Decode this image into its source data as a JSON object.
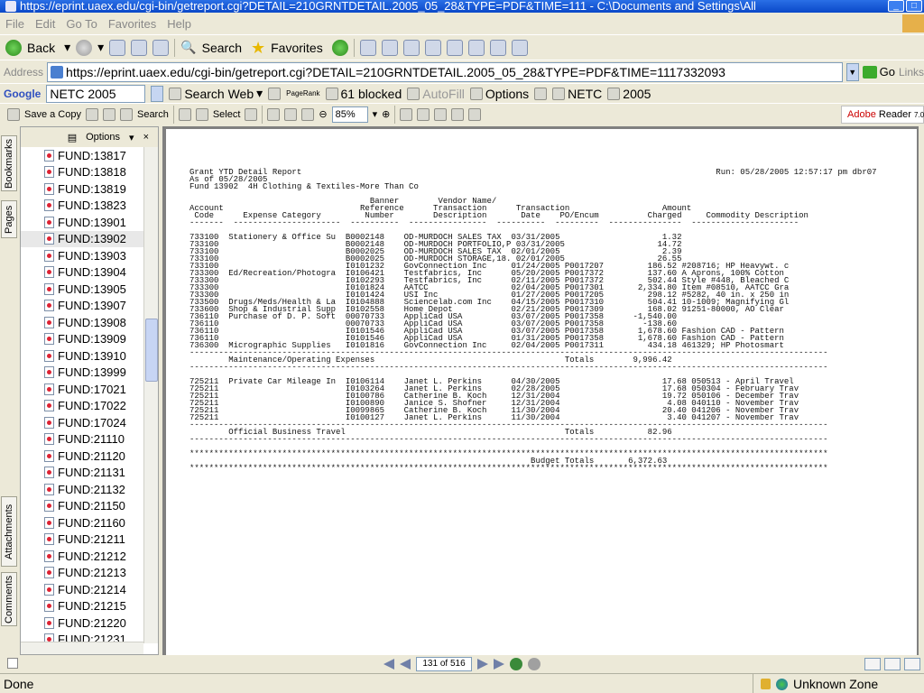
{
  "window": {
    "title": "https://eprint.uaex.edu/cgi-bin/getreport.cgi?DETAIL=210GRNTDETAIL.2005_05_28&TYPE=PDF&TIME=111 - C:\\Documents and Settings\\All"
  },
  "menu": [
    "File",
    "Edit",
    "Go To",
    "Favorites",
    "Help"
  ],
  "nav": {
    "back": "Back",
    "search": "Search",
    "favorites": "Favorites"
  },
  "address": {
    "label": "Address",
    "url": "https://eprint.uaex.edu/cgi-bin/getreport.cgi?DETAIL=210GRNTDETAIL.2005_05_28&TYPE=PDF&TIME=1117332093",
    "go": "Go",
    "links": "Links"
  },
  "google": {
    "logo": "Google",
    "query": "NETC 2005",
    "search_web": "Search Web",
    "pagerank": "PageRank",
    "blocked": "61 blocked",
    "autofill": "AutoFill",
    "options": "Options",
    "term1": "NETC",
    "term2": "2005"
  },
  "acrobat": {
    "save_copy": "Save a Copy",
    "search": "Search",
    "select": "Select",
    "zoom": "85%",
    "reader_brand_a": "Adobe",
    "reader_brand_b": "Reader",
    "reader_version": "7.0"
  },
  "side_tabs": [
    "Bookmarks",
    "Pages",
    "Attachments",
    "Comments"
  ],
  "bookmarks": {
    "options_label": "Options",
    "close": "×",
    "items": [
      "FUND:13817",
      "FUND:13818",
      "FUND:13819",
      "FUND:13823",
      "FUND:13901",
      "FUND:13902",
      "FUND:13903",
      "FUND:13904",
      "FUND:13905",
      "FUND:13907",
      "FUND:13908",
      "FUND:13909",
      "FUND:13910",
      "FUND:13999",
      "FUND:17021",
      "FUND:17022",
      "FUND:17024",
      "FUND:21110",
      "FUND:21120",
      "FUND:21131",
      "FUND:21132",
      "FUND:21150",
      "FUND:21160",
      "FUND:21211",
      "FUND:21212",
      "FUND:21213",
      "FUND:21214",
      "FUND:21215",
      "FUND:21220",
      "FUND:21231"
    ],
    "selected_index": 5
  },
  "report": {
    "lines": [
      "Grant YTD Detail Report                                                                                     Run: 05/28/2005 12:57:17 pm dbr07",
      "As of 05/28/2005",
      "Fund 13902  4H Clothing & Textiles-More Than Co",
      "",
      "                                     Banner        Vendor Name/",
      "Account                            Reference      Transaction      Transaction                   Amount",
      " Code      Expense Category         Number        Description       Date    PO/Encum          Charged     Commodity Description",
      "-------  ----------------------  ----------  ----------------  ----------  ---------  ---------------  ----------------------",
      "",
      "733100  Stationery & Office Su  B0002148    OD-MURDOCH SALES TAX  03/31/2005                     1.32",
      "733100                          B0002148    OD-MURDOCH PORTFOLIO,P 03/31/2005                   14.72",
      "733100                          B0002025    OD-MURDOCH SALES TAX  02/01/2005                     2.39",
      "733100                          B0002025    OD-MURDOCH STORAGE,18. 02/01/2005                   26.55",
      "733100                          I0101232    GovConnection Inc     01/24/2005 P0017207         186.52 #208716; HP Heavywt. c",
      "733300  Ed/Recreation/Photogra  I0106421    Testfabrics, Inc      05/20/2005 P0017372         137.60 A Aprons, 100% Cotton",
      "733300                          I0102293    Testfabrics, Inc      02/11/2005 P0017372         502.44 Style #448, Bleached C",
      "733300                          I0101824    AATCC                 02/04/2005 P0017301       2,334.80 Item #08510, AATCC Gra",
      "733300                          I0101424    USI Inc               01/27/2005 P0017205         298.12 #5282, 40 in. x 250 in",
      "733500  Drugs/Meds/Health & La  I0104888    Sciencelab.com Inc    04/15/2005 P0017310         504.41 10-1009; Magnifying Gl",
      "733600  Shop & Industrial Supp  I0102558    Home Depot            02/21/2005 P0017309         168.02 91251-80000, AO Clear",
      "736110  Purchase of D. P. Soft  00070733    AppliCad USA          03/07/2005 P0017358      -1,540.00",
      "736110                          00070733    AppliCad USA          03/07/2005 P0017358        -138.60",
      "736110                          I0101546    AppliCad USA          03/07/2005 P0017358       1,678.60 Fashion CAD - Pattern",
      "736110                          I0101546    AppliCad USA          01/31/2005 P0017358       1,678.60 Fashion CAD - Pattern",
      "736300  Micrographic Supplies   I0101816    GovConnection Inc     02/04/2005 P0017311         434.18 461329; HP Photosmart",
      "-----------------------------------------------------------------------------------------------------------------------------------",
      "        Maintenance/Operating Expenses                                       Totals        9,996.42",
      "-----------------------------------------------------------------------------------------------------------------------------------",
      "",
      "725211  Private Car Mileage In  I0106114    Janet L. Perkins      04/30/2005                     17.68 050513 - April Travel",
      "725211                          I0103264    Janet L. Perkins      02/28/2005                     17.68 050304 - February Trav",
      "725211                          I0100786    Catherine B. Koch     12/31/2004                     19.72 050106 - December Trav",
      "725211                          I0100890    Janice S. Shofner     12/31/2004                      4.08 040110 - November Trav",
      "725211                          I0099865    Catherine B. Koch     11/30/2004                     20.40 041206 - November Trav",
      "725211                          I0100127    Janet L. Perkins      11/30/2004                      3.40 041207 - November Trav",
      "-----------------------------------------------------------------------------------------------------------------------------------",
      "        Official Business Travel                                             Totals           82.96",
      "-----------------------------------------------------------------------------------------------------------------------------------",
      "",
      "***********************************************************************************************************************************",
      "                                                                      Budget Totals       6,372.63",
      "***********************************************************************************************************************************"
    ]
  },
  "pager": {
    "page": "131 of 516"
  },
  "status": {
    "text": "Done",
    "zone": "Unknown Zone"
  }
}
